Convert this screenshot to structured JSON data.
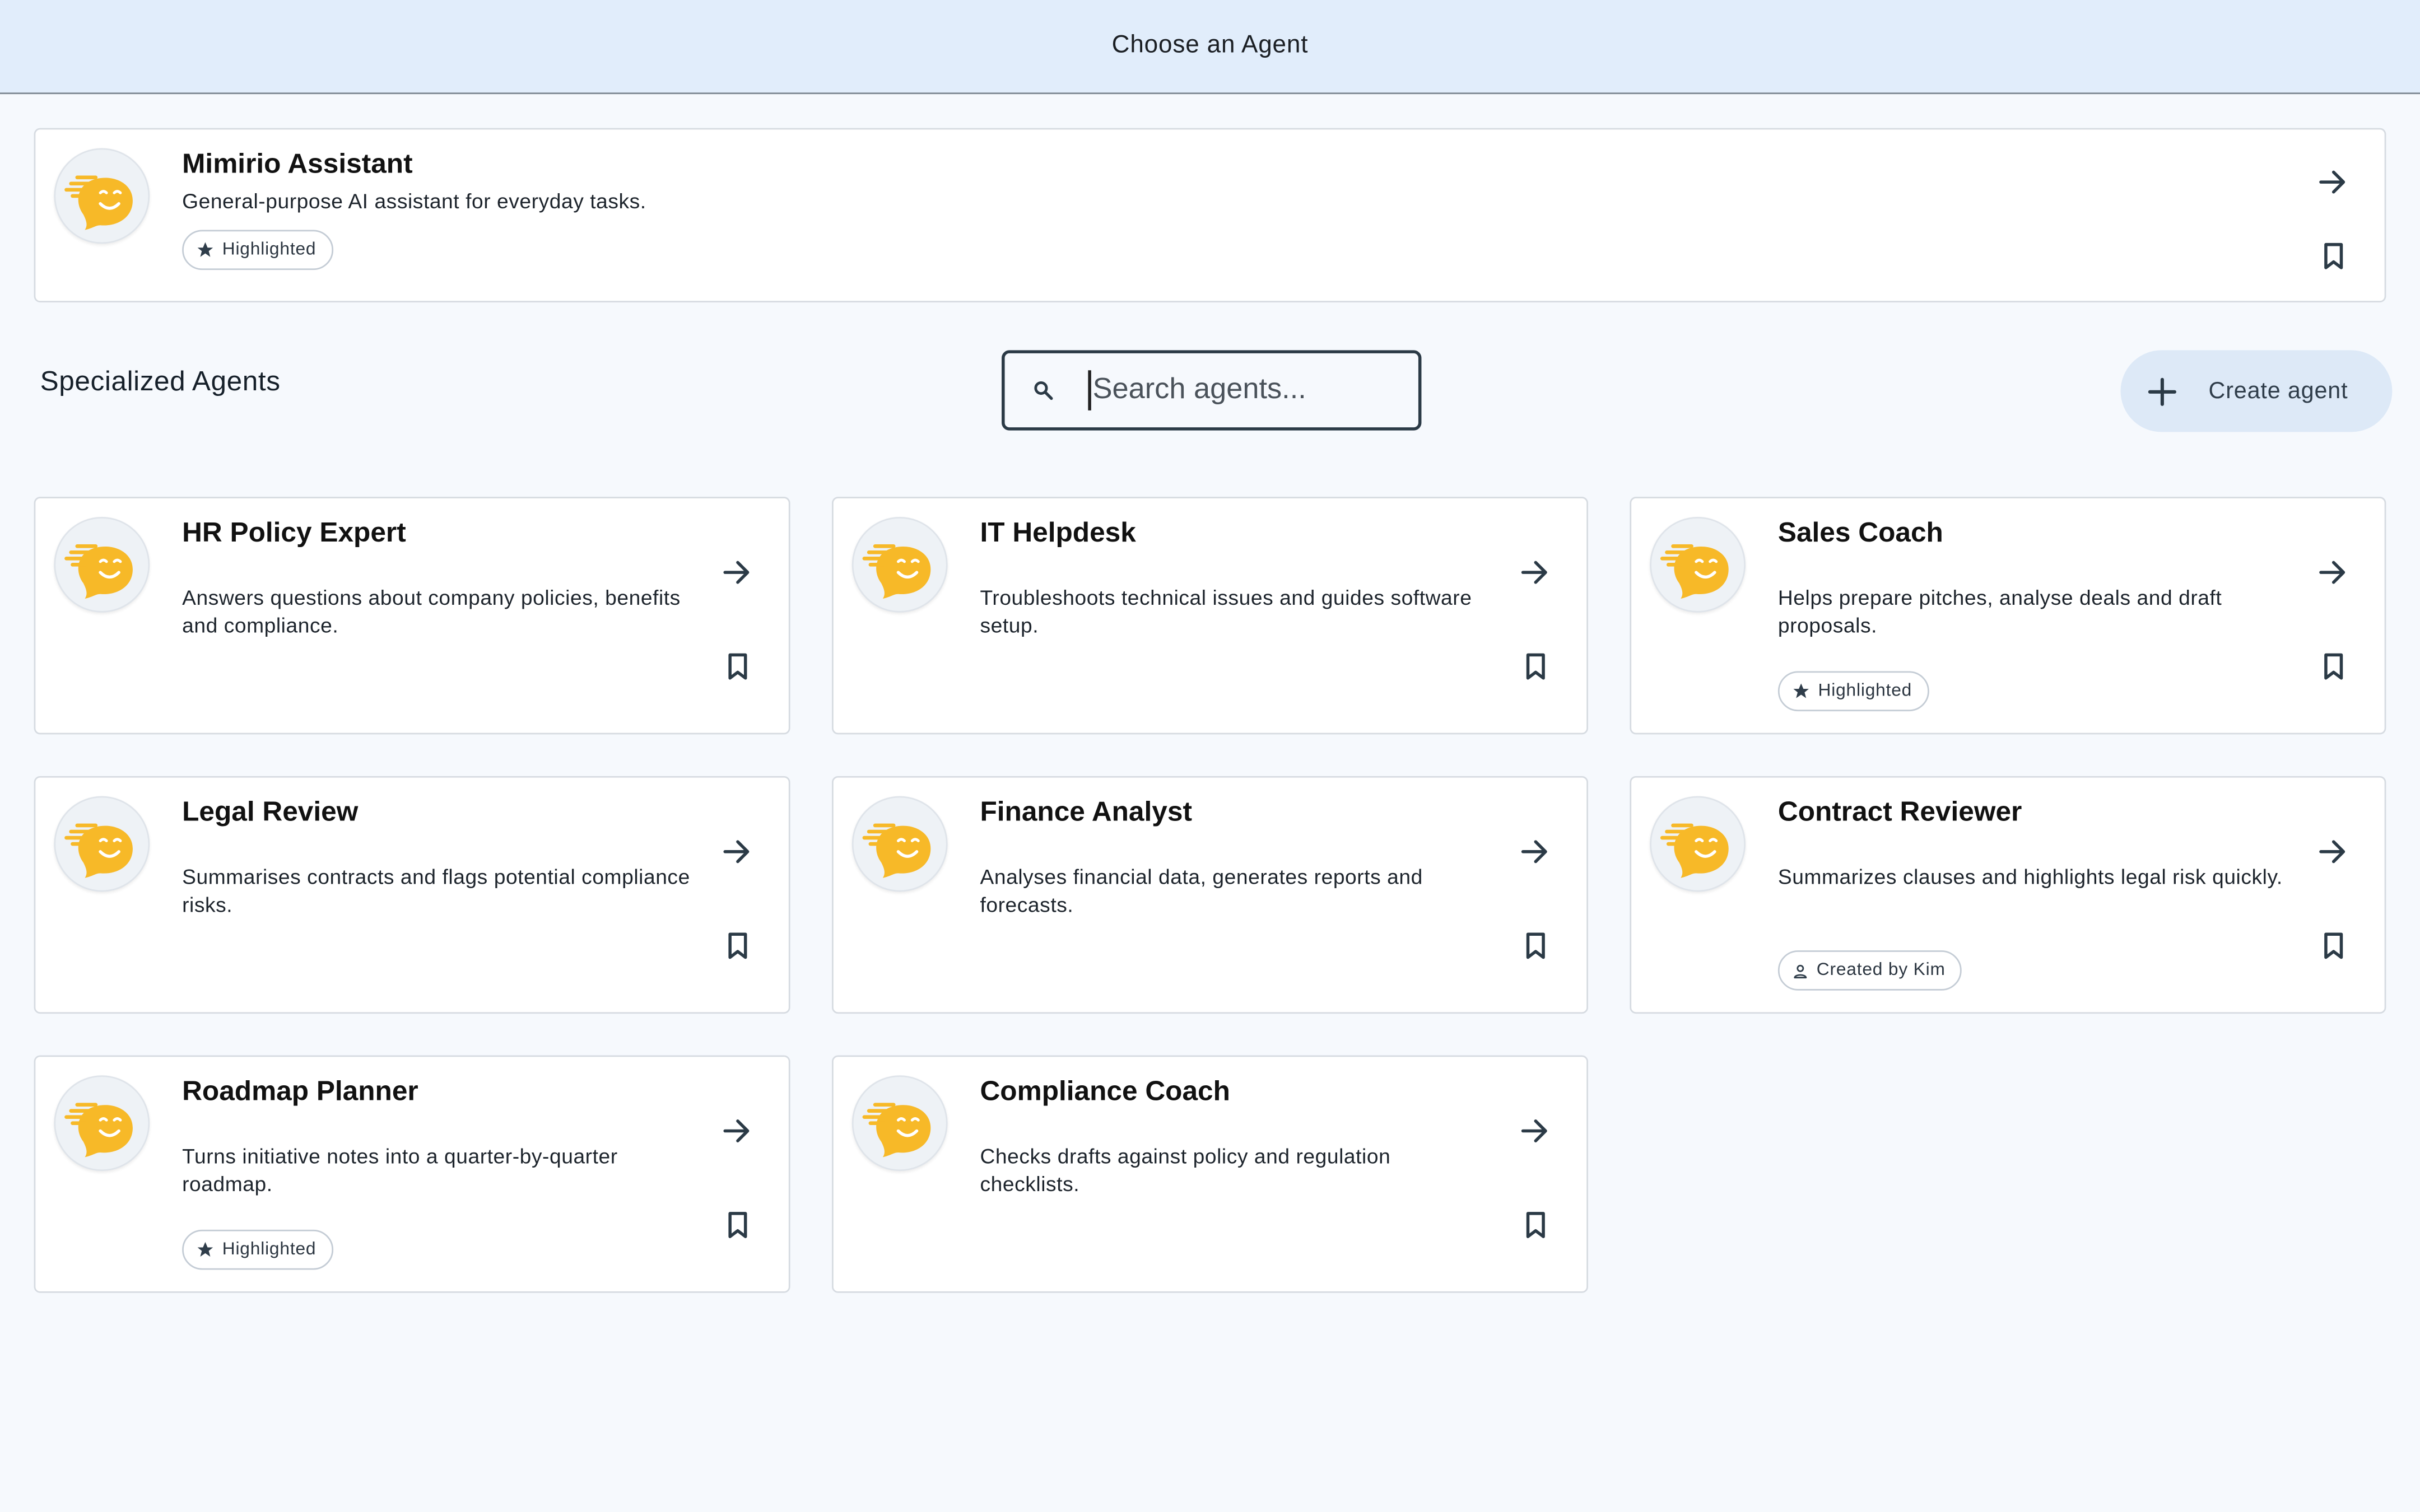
{
  "header": {
    "title": "Choose an Agent"
  },
  "featured": {
    "name": "Mimirio Assistant",
    "description": "General-purpose AI assistant for everyday tasks.",
    "badge": "Highlighted"
  },
  "section": {
    "title": "Specialized Agents"
  },
  "search": {
    "placeholder": "Search agents..."
  },
  "create": {
    "label": "Create agent"
  },
  "agents": [
    {
      "name": "HR Policy Expert",
      "description": "Answers questions about company policies, benefits and compliance.",
      "badge": ""
    },
    {
      "name": "IT Helpdesk",
      "description": "Troubleshoots technical issues and guides software setup.",
      "badge": ""
    },
    {
      "name": "Sales Coach",
      "description": "Helps prepare pitches, analyse deals and draft proposals.",
      "badge": "Highlighted"
    },
    {
      "name": "Legal Review",
      "description": "Summarises contracts and flags potential compliance risks.",
      "badge": ""
    },
    {
      "name": "Finance Analyst",
      "description": "Analyses financial data, generates reports and forecasts.",
      "badge": ""
    },
    {
      "name": "Contract Reviewer",
      "description": "Summarizes clauses and highlights legal risk quickly.",
      "badge": "Created by Kim"
    },
    {
      "name": "Roadmap Planner",
      "description": "Turns initiative notes into a quarter-by-quarter roadmap.",
      "badge": "Highlighted"
    },
    {
      "name": "Compliance Coach",
      "description": "Checks drafts against policy and regulation checklists.",
      "badge": ""
    }
  ],
  "icons": {
    "avatar": "mascot-avatar-icon",
    "open": "arrow-right-icon",
    "bookmark": "bookmark-icon",
    "highlighted": "star-icon",
    "creator": "person-icon",
    "search": "search-icon",
    "add": "plus-icon"
  },
  "colors": {
    "header_bg": "#e1edfb",
    "accent": "#f7b928",
    "create_bg": "#dde9f7"
  }
}
